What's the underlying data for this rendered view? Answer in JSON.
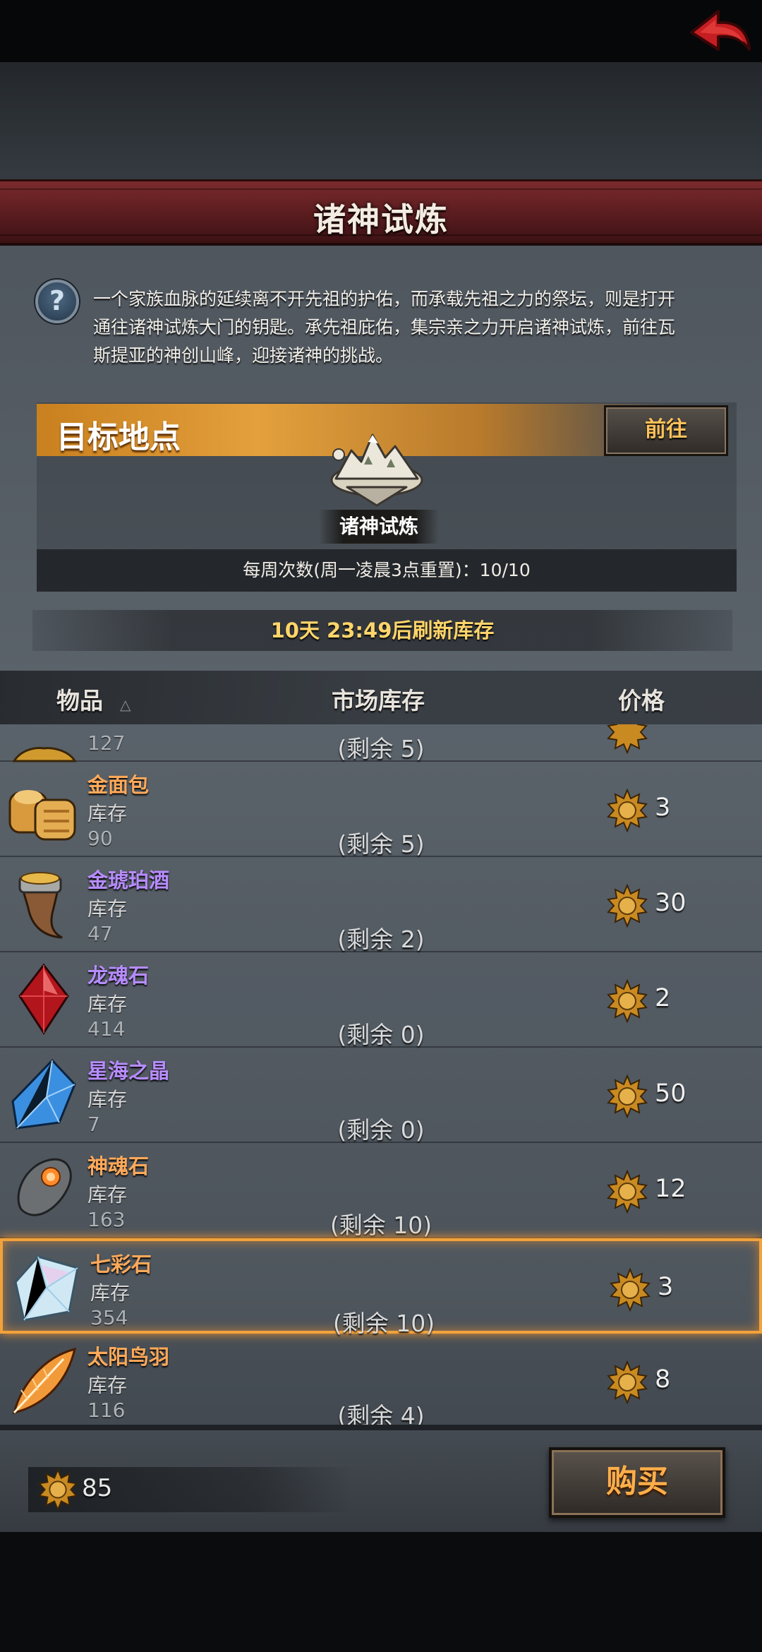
{
  "header": {
    "title": "诸神试炼"
  },
  "intro": {
    "text": "一个家族血脉的延续离不开先祖的护佑，而承载先祖之力的祭坛，则是打开通往诸神试炼大门的钥匙。承先祖庇佑，集宗亲之力开启诸神试炼，前往瓦斯提亚的神创山峰，迎接诸神的挑战。"
  },
  "target": {
    "label": "目标地点",
    "goto_button": "前往",
    "location_name": "诸神试炼",
    "weekly_count": "每周次数(周一凌晨3点重置)：10/10"
  },
  "refresh_text": "10天 23:49后刷新库存",
  "table": {
    "col_item": "物品",
    "col_market_stock": "市场库存",
    "col_price": "价格"
  },
  "partial_row": {
    "stock_value": "127",
    "remaining": "(剩余 5)"
  },
  "items": [
    {
      "name": "金面包",
      "name_color": "orange",
      "icon": "bread-icon",
      "stock_label": "库存",
      "stock_value": "90",
      "remaining": "(剩余 5)",
      "price": "3"
    },
    {
      "name": "金琥珀酒",
      "name_color": "purple",
      "icon": "horn-mead-icon",
      "stock_label": "库存",
      "stock_value": "47",
      "remaining": "(剩余 2)",
      "price": "30"
    },
    {
      "name": "龙魂石",
      "name_color": "purple",
      "icon": "red-crystal-icon",
      "stock_label": "库存",
      "stock_value": "414",
      "remaining": "(剩余 0)",
      "price": "2"
    },
    {
      "name": "星海之晶",
      "name_color": "purple",
      "icon": "blue-crystal-icon",
      "stock_label": "库存",
      "stock_value": "7",
      "remaining": "(剩余 0)",
      "price": "50"
    },
    {
      "name": "神魂石",
      "name_color": "orange",
      "icon": "soul-stone-icon",
      "stock_label": "库存",
      "stock_value": "163",
      "remaining": "(剩余 10)",
      "price": "12"
    },
    {
      "name": "七彩石",
      "name_color": "orange",
      "icon": "rainbow-stone-icon",
      "stock_label": "库存",
      "stock_value": "354",
      "remaining": "(剩余 10)",
      "price": "3",
      "selected": true
    },
    {
      "name": "太阳鸟羽",
      "name_color": "orange",
      "icon": "sunbird-feather-icon",
      "stock_label": "库存",
      "stock_value": "116",
      "remaining": "(剩余 4)",
      "price": "8"
    }
  ],
  "footer": {
    "balance": "85",
    "buy_button": "购买"
  },
  "colors": {
    "accent_orange": "#ffa95a",
    "rare_purple": "#b78cff",
    "title_red": "#6a2224",
    "selection_glow": "#f2a23c"
  }
}
